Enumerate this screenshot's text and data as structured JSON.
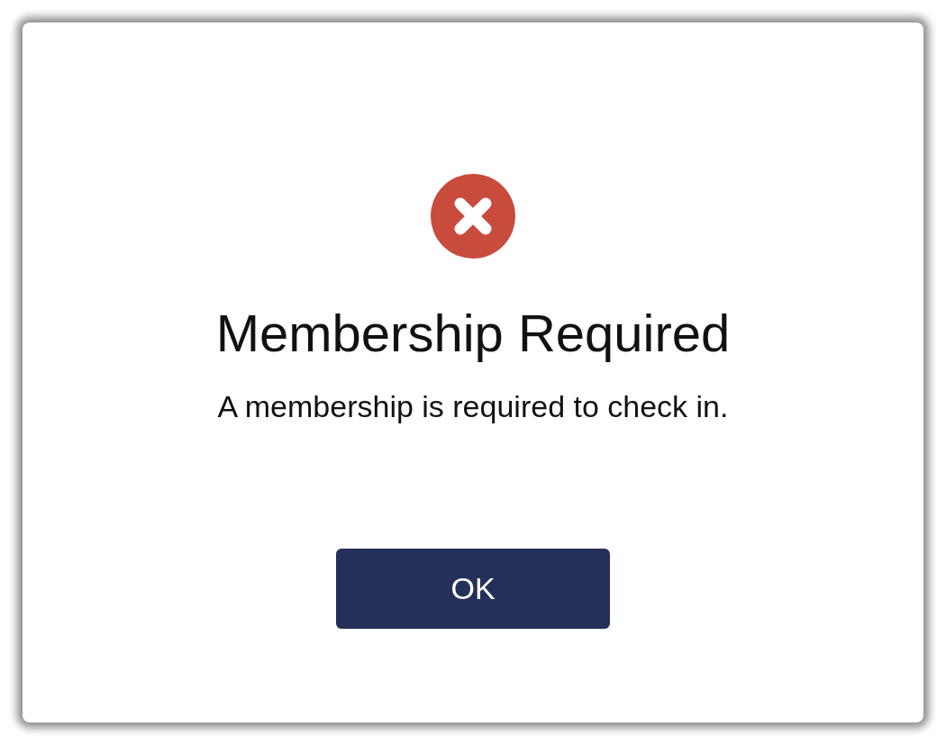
{
  "dialog": {
    "icon": {
      "kind": "error"
    },
    "title": "Membership Required",
    "message": "A membership is required to check in.",
    "buttons": [
      {
        "label": "OK"
      }
    ]
  }
}
